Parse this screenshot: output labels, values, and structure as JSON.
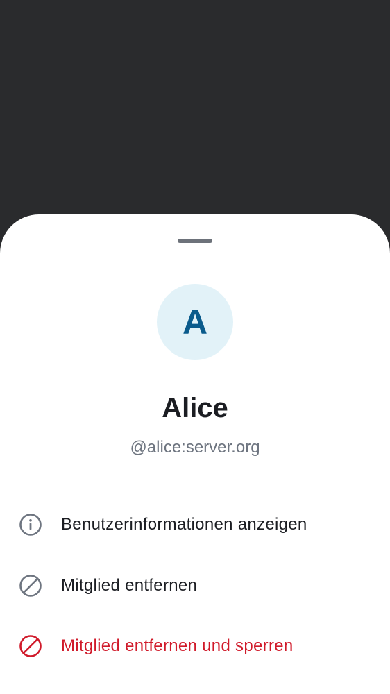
{
  "member": {
    "avatar_letter": "A",
    "display_name": "Alice",
    "user_id": "@alice:server.org"
  },
  "actions": [
    {
      "label": "Benutzerinformationen anzeigen",
      "icon": "info-icon",
      "color": "#6e7580"
    },
    {
      "label": "Mitglied entfernen",
      "icon": "block-icon",
      "color": "#6e7580"
    },
    {
      "label": "Mitglied entfernen und sperren",
      "icon": "ban-icon",
      "color": "#d01a2a"
    }
  ],
  "colors": {
    "backdrop": "#2a2b2d",
    "avatar_bg": "#e2f2f8",
    "avatar_fg": "#0a5b8c",
    "danger": "#d01a2a"
  }
}
